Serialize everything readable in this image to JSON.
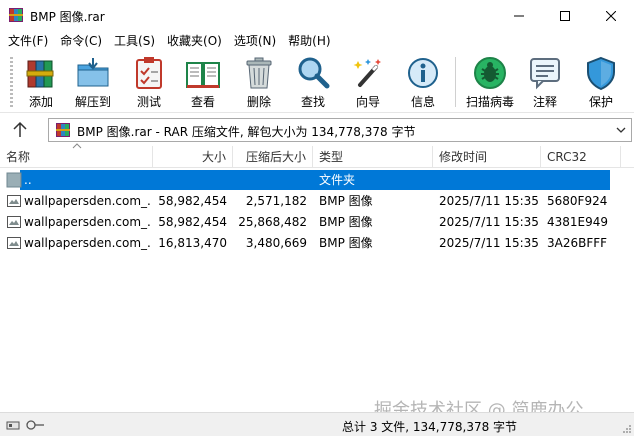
{
  "window": {
    "title": "BMP 图像.rar"
  },
  "menu": [
    {
      "label": "文件(F)"
    },
    {
      "label": "命令(C)"
    },
    {
      "label": "工具(S)"
    },
    {
      "label": "收藏夹(O)"
    },
    {
      "label": "选项(N)"
    },
    {
      "label": "帮助(H)"
    }
  ],
  "toolbar": [
    {
      "label": "添加",
      "icon": "add-books-icon"
    },
    {
      "label": "解压到",
      "icon": "extract-folder-icon"
    },
    {
      "label": "测试",
      "icon": "test-clipboard-icon"
    },
    {
      "label": "查看",
      "icon": "view-book-icon"
    },
    {
      "label": "删除",
      "icon": "trash-icon"
    },
    {
      "label": "查找",
      "icon": "magnifier-icon"
    },
    {
      "label": "向导",
      "icon": "wizard-wand-icon"
    },
    {
      "label": "信息",
      "icon": "info-icon"
    },
    {
      "label": "扫描病毒",
      "icon": "virus-scan-icon"
    },
    {
      "label": "注释",
      "icon": "comment-icon"
    },
    {
      "label": "保护",
      "icon": "shield-icon"
    }
  ],
  "address": {
    "text": "BMP 图像.rar - RAR 压缩文件, 解包大小为 134,778,378 字节"
  },
  "columns": {
    "name": "名称",
    "size": "大小",
    "packed": "压缩后大小",
    "type": "类型",
    "modified": "修改时间",
    "crc": "CRC32"
  },
  "rows": [
    {
      "name": "..",
      "size": "",
      "packed": "",
      "type": "文件夹",
      "modified": "",
      "crc": ""
    },
    {
      "name": "wallpapersden.com_...",
      "size": "58,982,454",
      "packed": "2,571,182",
      "type": "BMP 图像",
      "modified": "2025/7/11 15:35",
      "crc": "5680F924"
    },
    {
      "name": "wallpapersden.com_...",
      "size": "58,982,454",
      "packed": "25,868,482",
      "type": "BMP 图像",
      "modified": "2025/7/11 15:35",
      "crc": "4381E949"
    },
    {
      "name": "wallpapersden.com_...",
      "size": "16,813,470",
      "packed": "3,480,669",
      "type": "BMP 图像",
      "modified": "2025/7/11 15:35",
      "crc": "3A26BFFF"
    }
  ],
  "status": {
    "text": "总计 3 文件, 134,778,378 字节"
  },
  "watermark": "掘金技术社区 @ 简鹿办公",
  "colors": {
    "selection": "#0078d7",
    "accent": "#1e5aa8"
  }
}
